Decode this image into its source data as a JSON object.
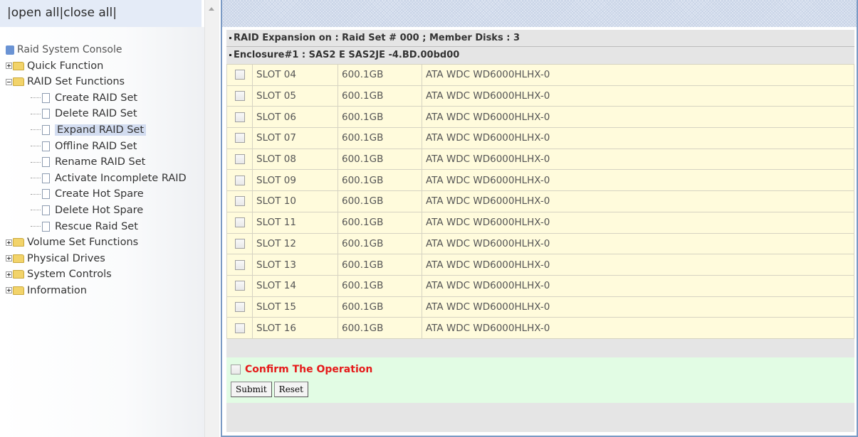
{
  "topbar": {
    "open_all": "open all",
    "close_all": "close all"
  },
  "tree": {
    "root": "Raid System Console",
    "folders": {
      "quick": "Quick Function",
      "raidset": "RAID Set Functions",
      "volume": "Volume Set Functions",
      "physical": "Physical Drives",
      "system": "System Controls",
      "info": "Information"
    },
    "raidset_children": [
      "Create RAID Set",
      "Delete RAID Set",
      "Expand RAID Set",
      "Offline RAID Set",
      "Rename RAID Set",
      "Activate Incomplete RAID",
      "Create Hot Spare",
      "Delete Hot Spare",
      "Rescue Raid Set"
    ],
    "selected": "Expand RAID Set"
  },
  "content": {
    "title": "RAID Expansion on : Raid Set # 000 ; Member Disks : 3",
    "enclosure": "Enclosure#1 : SAS2 E SAS2JE -4.BD.00bd00",
    "disks": [
      {
        "slot": "SLOT 04",
        "size": "600.1GB",
        "model": "ATA WDC WD6000HLHX-0"
      },
      {
        "slot": "SLOT 05",
        "size": "600.1GB",
        "model": "ATA WDC WD6000HLHX-0"
      },
      {
        "slot": "SLOT 06",
        "size": "600.1GB",
        "model": "ATA WDC WD6000HLHX-0"
      },
      {
        "slot": "SLOT 07",
        "size": "600.1GB",
        "model": "ATA WDC WD6000HLHX-0"
      },
      {
        "slot": "SLOT 08",
        "size": "600.1GB",
        "model": "ATA WDC WD6000HLHX-0"
      },
      {
        "slot": "SLOT 09",
        "size": "600.1GB",
        "model": "ATA WDC WD6000HLHX-0"
      },
      {
        "slot": "SLOT 10",
        "size": "600.1GB",
        "model": "ATA WDC WD6000HLHX-0"
      },
      {
        "slot": "SLOT 11",
        "size": "600.1GB",
        "model": "ATA WDC WD6000HLHX-0"
      },
      {
        "slot": "SLOT 12",
        "size": "600.1GB",
        "model": "ATA WDC WD6000HLHX-0"
      },
      {
        "slot": "SLOT 13",
        "size": "600.1GB",
        "model": "ATA WDC WD6000HLHX-0"
      },
      {
        "slot": "SLOT 14",
        "size": "600.1GB",
        "model": "ATA WDC WD6000HLHX-0"
      },
      {
        "slot": "SLOT 15",
        "size": "600.1GB",
        "model": "ATA WDC WD6000HLHX-0"
      },
      {
        "slot": "SLOT 16",
        "size": "600.1GB",
        "model": "ATA WDC WD6000HLHX-0"
      }
    ],
    "confirm_label": "Confirm The Operation",
    "submit_label": "Submit",
    "reset_label": "Reset"
  },
  "colors": {
    "disk_row_bg": "#fffbdc",
    "confirm_bg": "#e2fce4",
    "confirm_text": "#e51a1a",
    "header_bg": "#e5e5e5",
    "frame_border": "#7b9ac4"
  }
}
